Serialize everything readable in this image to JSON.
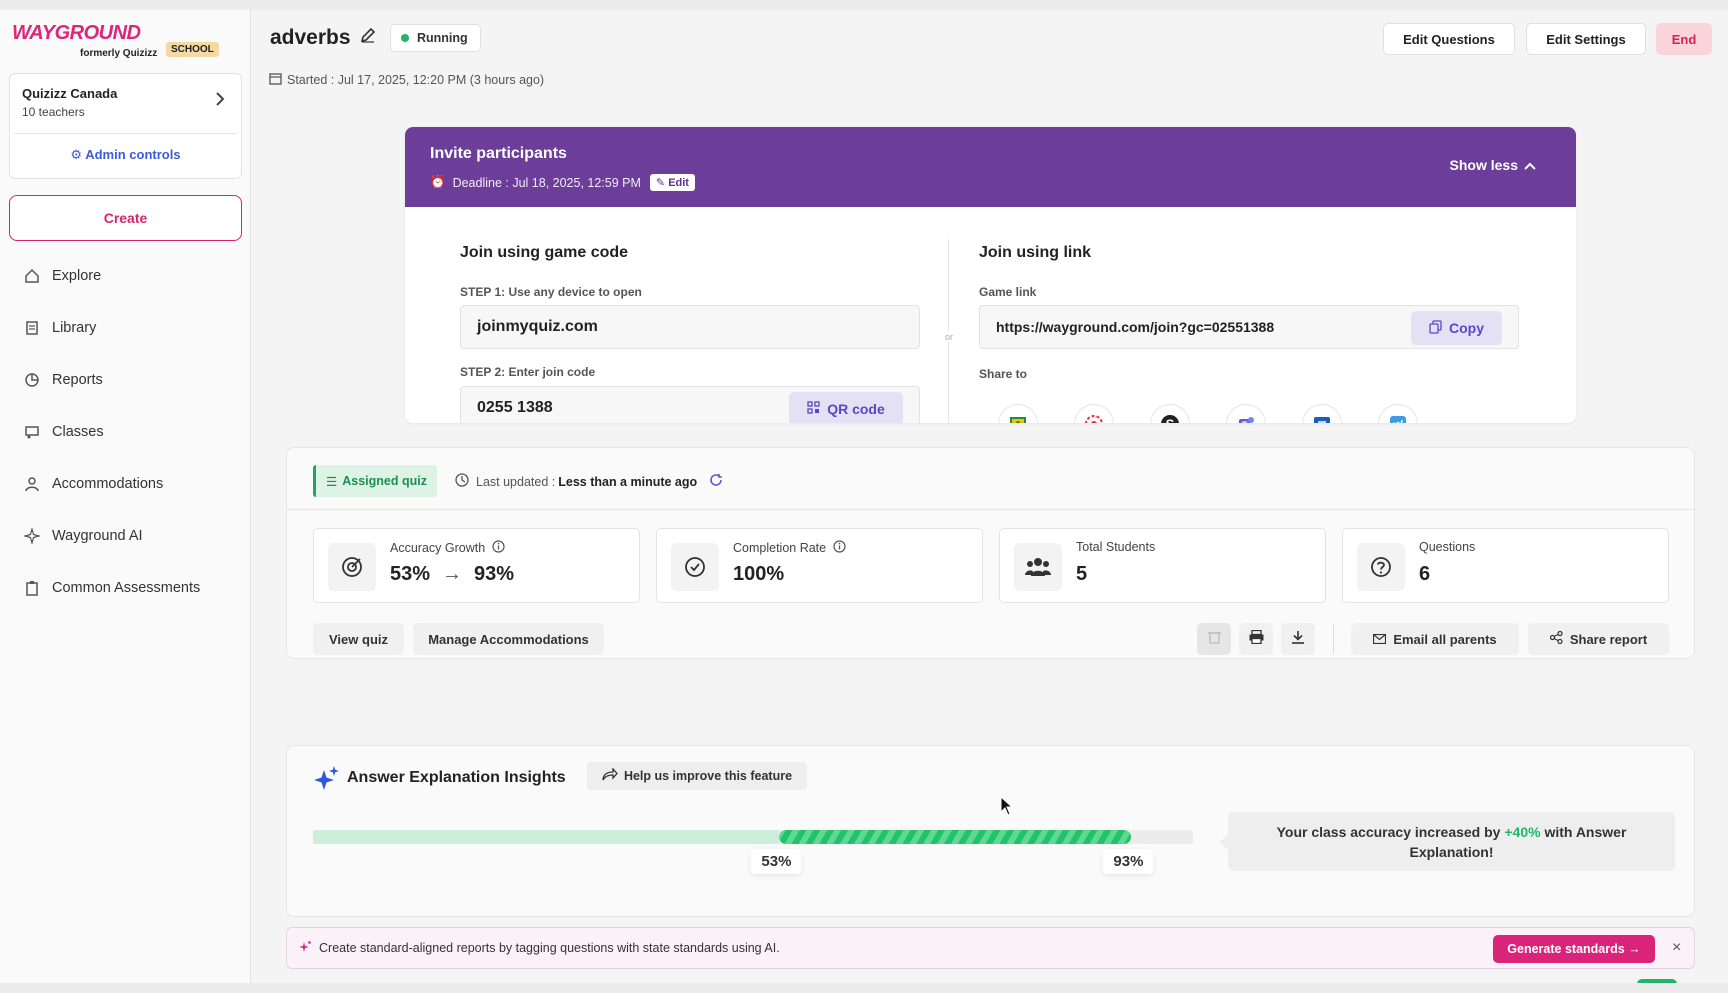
{
  "brand": {
    "name": "WAYGROUND",
    "sub": "formerly Quizizz",
    "badge": "SCHOOL",
    "color": "#e0247a"
  },
  "org": {
    "name": "Quizizz Canada",
    "teachers": "10 teachers",
    "admin": "Admin controls"
  },
  "sidebar": {
    "create": "Create",
    "items": [
      {
        "label": "Explore",
        "icon": "home-icon"
      },
      {
        "label": "Library",
        "icon": "library-icon"
      },
      {
        "label": "Reports",
        "icon": "reports-icon"
      },
      {
        "label": "Classes",
        "icon": "classes-icon"
      },
      {
        "label": "Accommodations",
        "icon": "accommodations-icon"
      },
      {
        "label": "Wayground AI",
        "icon": "sparkle-icon"
      },
      {
        "label": "Common Assessments",
        "icon": "clipboard-icon"
      }
    ]
  },
  "header": {
    "title": "adverbs",
    "status": "Running",
    "started": "Started : Jul 17, 2025, 12:20 PM (3 hours ago)",
    "edit_questions": "Edit Questions",
    "edit_settings": "Edit Settings",
    "end": "End"
  },
  "invite": {
    "title": "Invite participants",
    "deadline": "Deadline : Jul 18, 2025, 12:59 PM",
    "edit": "Edit",
    "show_less": "Show less",
    "code_heading": "Join using game code",
    "step1": "STEP 1: Use any device to open",
    "site": "joinmyquiz.com",
    "step2": "STEP 2: Enter join code",
    "code": "0255 1388",
    "qr": "QR code",
    "or": "or",
    "link_heading": "Join using link",
    "game_link_label": "Game link",
    "game_link": "https://wayground.com/join?gc=02551388",
    "copy": "Copy",
    "share_to": "Share to",
    "share_icons": [
      "google-classroom-icon",
      "schoology-icon",
      "skype-icon",
      "teams-icon",
      "remind-icon",
      "twitter-icon"
    ]
  },
  "stats": {
    "assigned": "Assigned quiz",
    "updated_label": "Last updated :",
    "updated_value": "Less than a minute ago",
    "cards": {
      "accuracy": {
        "label": "Accuracy Growth",
        "from": "53%",
        "to": "93%"
      },
      "completion": {
        "label": "Completion Rate",
        "value": "100%"
      },
      "students": {
        "label": "Total Students",
        "value": "5"
      },
      "questions": {
        "label": "Questions",
        "value": "6"
      }
    },
    "view_quiz": "View quiz",
    "manage_accommodations": "Manage Accommodations",
    "email_parents": "Email all parents",
    "share_report": "Share report"
  },
  "insights": {
    "title": "Answer Explanation Insights",
    "help": "Help us improve this feature",
    "from_value": 53,
    "to_value": 93,
    "from_label": "53%",
    "to_label": "93%",
    "msg_pre": "Your class accuracy increased by",
    "msg_pct": "+40%",
    "msg_post": "with Answer Explanation!"
  },
  "banner": {
    "text": "Create standard-aligned reports by tagging questions with state standards using AI.",
    "button": "Generate standards →",
    "close": "×"
  }
}
